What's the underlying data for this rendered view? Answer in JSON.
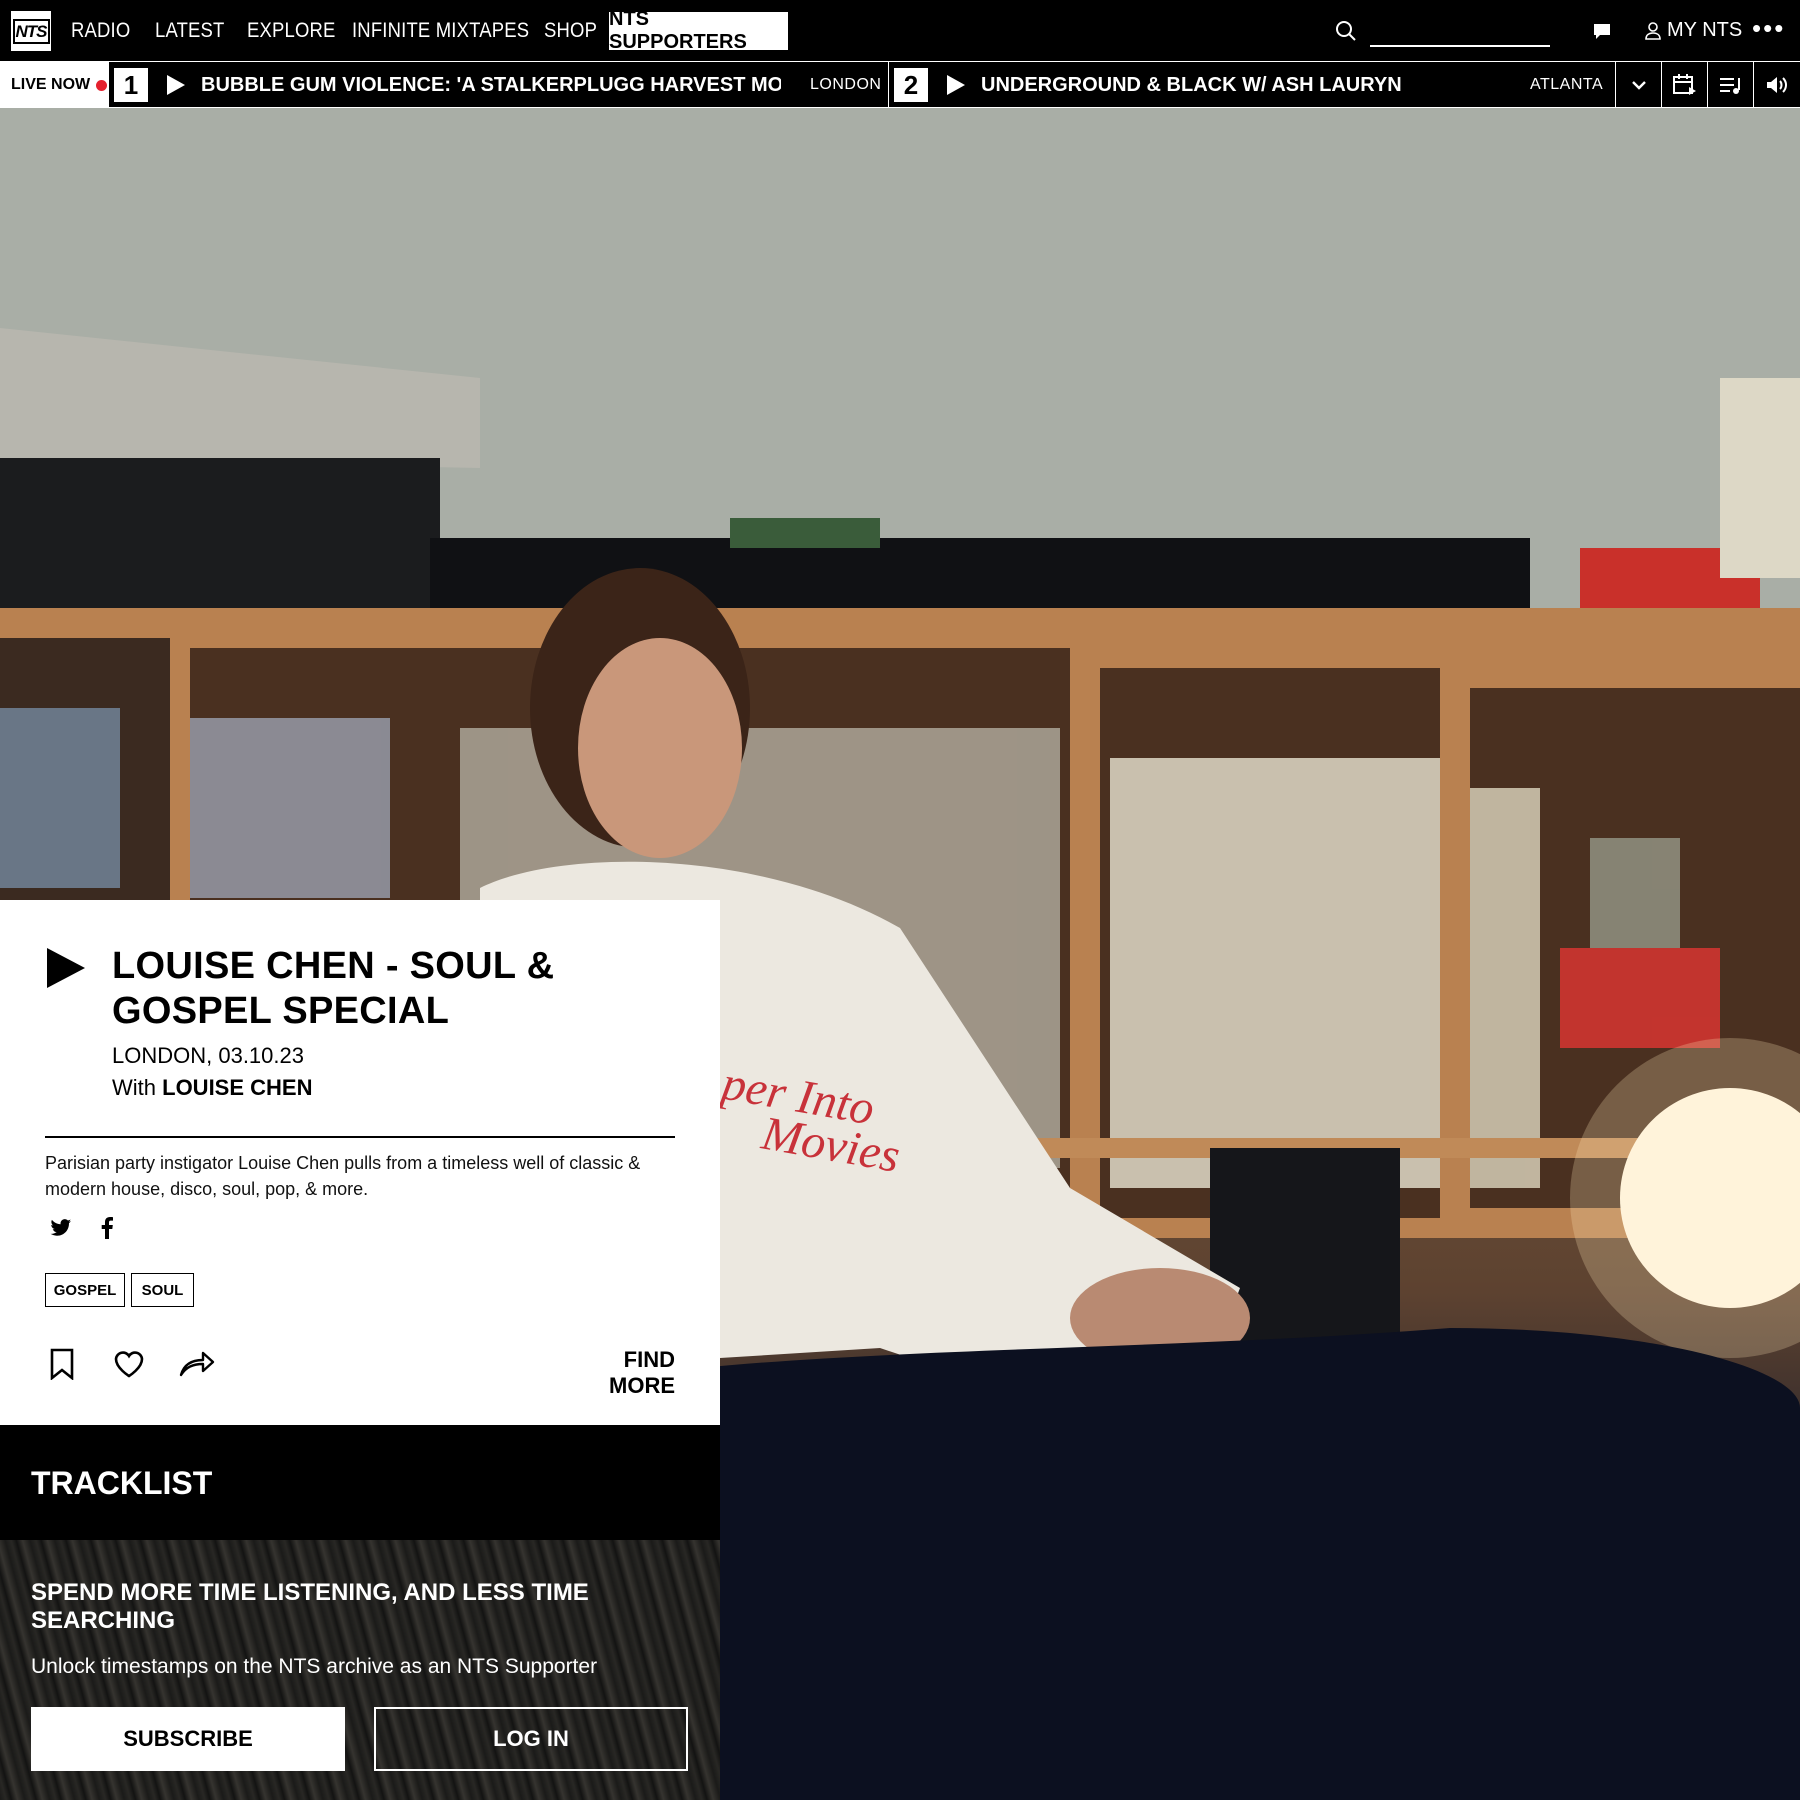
{
  "nav": {
    "logo_text": "NTS",
    "items": [
      {
        "label": "RADIO"
      },
      {
        "label": "LATEST"
      },
      {
        "label": "EXPLORE"
      },
      {
        "label": "INFINITE MIXTAPES"
      },
      {
        "label": "SHOP"
      }
    ],
    "supporters_label": "NTS SUPPORTERS",
    "search_placeholder": "",
    "my_nts_label": "MY NTS",
    "more_label": "•••"
  },
  "live": {
    "label": "LIVE NOW",
    "channels": [
      {
        "number": "1",
        "title": "BUBBLE GUM VIOLENCE: 'A STALKERPLUGG HARVEST MOON' HOSTE...",
        "city": "LONDON"
      },
      {
        "number": "2",
        "title": "UNDERGROUND & BLACK W/ ASH LAURYN",
        "city": "ATLANTA"
      }
    ]
  },
  "episode": {
    "title": "LOUISE CHEN - SOUL & GOSPEL SPECIAL",
    "location_date": "LONDON, 03.10.23",
    "with_prefix": "With",
    "host": "LOUISE CHEN",
    "description": "Parisian party instigator Louise Chen pulls from a timeless well of classic & modern house, disco, soul, pop, & more.",
    "tags": [
      "GOSPEL",
      "SOUL"
    ],
    "find_more_label": "FIND MORE"
  },
  "tracklist": {
    "title": "TRACKLIST"
  },
  "promo": {
    "heading": "SPEND MORE TIME LISTENING, AND LESS TIME SEARCHING",
    "text": "Unlock timestamps on the NTS archive as an NTS Supporter",
    "subscribe_label": "SUBSCRIBE",
    "login_label": "LOG IN"
  },
  "colors": {
    "accent_live": "#e5212e",
    "background": "#000000",
    "panel": "#ffffff"
  }
}
